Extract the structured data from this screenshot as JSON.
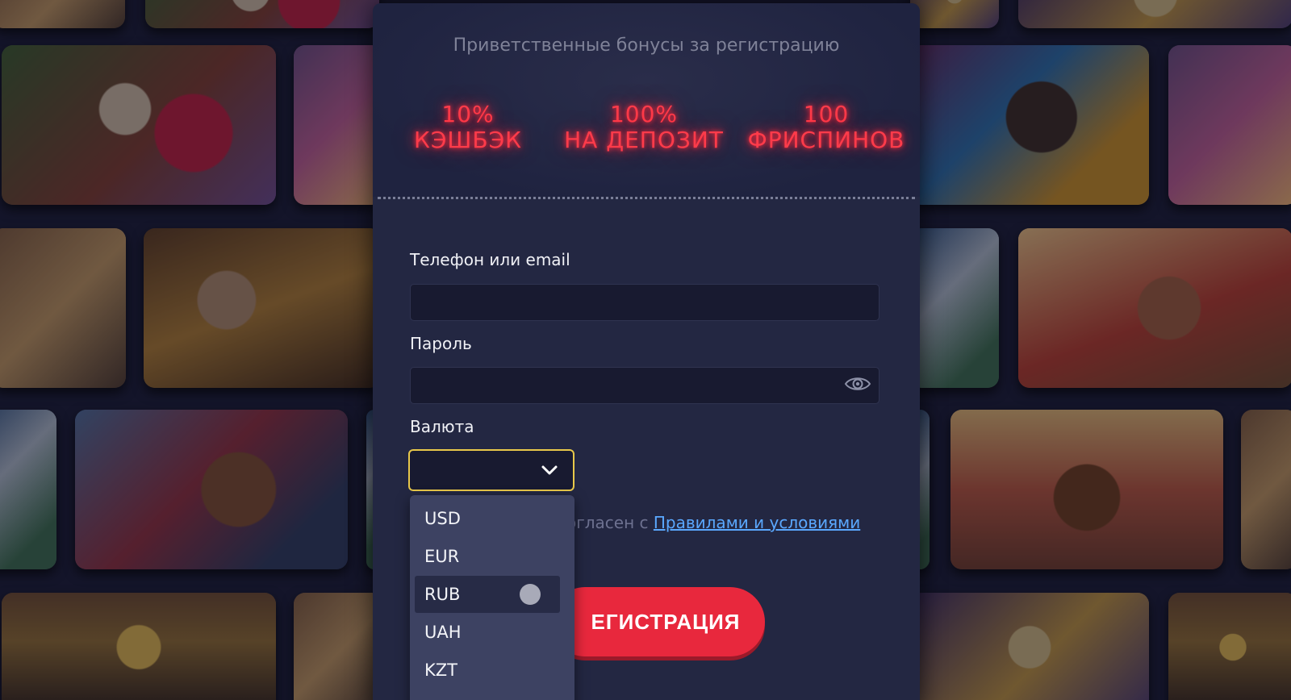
{
  "bonus": {
    "title": "Приветственные бонусы за регистрацию",
    "items": [
      {
        "line1": "10%",
        "line2": "КЭШБЭК"
      },
      {
        "line1": "100%",
        "line2": "НА ДЕПОЗИТ"
      },
      {
        "line1": "100",
        "line2": "ФРИСПИНОВ"
      }
    ]
  },
  "form": {
    "login_label": "Телефон или email",
    "login_value": "",
    "password_label": "Пароль",
    "password_value": "",
    "currency_label": "Валюта",
    "currency_value": "",
    "agree_text": "огласен с ",
    "agree_link": "Правилами и условиями",
    "register_label": "ЕГИСТРАЦИЯ"
  },
  "currency_options": [
    "USD",
    "EUR",
    "RUB",
    "UAH",
    "KZT"
  ],
  "highlighted_option": "RUB",
  "colors": {
    "accent_red": "#e8283d",
    "neon_red": "#ff3b4a",
    "select_focus": "#e8c84a",
    "link_blue": "#5aa8ff",
    "panel": "#232742"
  },
  "icons": [
    "eye-icon",
    "chevron-down-icon"
  ]
}
